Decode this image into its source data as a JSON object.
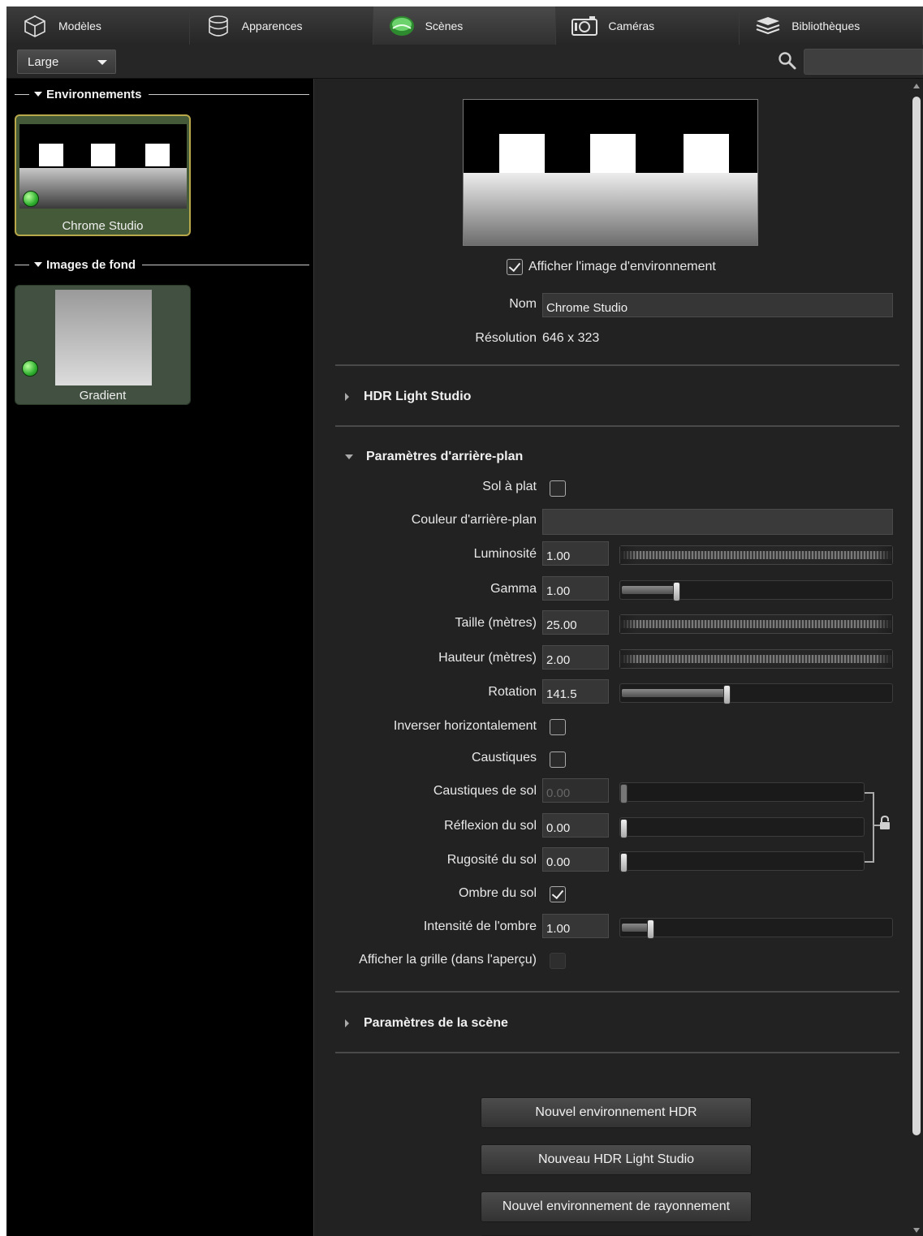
{
  "tabs": [
    {
      "label": "Modèles",
      "icon": "cube-icon"
    },
    {
      "label": "Apparences",
      "icon": "database-cylinder-icon"
    },
    {
      "label": "Scènes",
      "icon": "globe-scene-icon",
      "active": true
    },
    {
      "label": "Caméras",
      "icon": "camera-icon"
    },
    {
      "label": "Bibliothèques",
      "icon": "books-stack-icon"
    }
  ],
  "toolbar": {
    "size_select_value": "Large",
    "search_placeholder": ""
  },
  "library": {
    "environments_header": "Environnements",
    "environment_items": [
      {
        "label": "Chrome Studio",
        "selected": true
      }
    ],
    "backgrounds_header": "Images de fond",
    "background_items": [
      {
        "label": "Gradient"
      }
    ]
  },
  "details": {
    "show_env_image_label": "Afficher l'image d'environnement",
    "show_env_image_checked": true,
    "name_label": "Nom",
    "name_value": "Chrome Studio",
    "resolution_label": "Résolution",
    "resolution_value": "646 x 323",
    "hdr_light_studio_header": "HDR Light Studio",
    "background_params_header": "Paramètres d'arrière-plan",
    "scene_params_header": "Paramètres de la scène"
  },
  "params": {
    "flat_floor": {
      "label": "Sol à plat",
      "checked": false
    },
    "bg_color": {
      "label": "Couleur d'arrière-plan",
      "value": ""
    },
    "brightness": {
      "label": "Luminosité",
      "value": "1.00"
    },
    "gamma": {
      "label": "Gamma",
      "value": "1.00",
      "level": 0.2
    },
    "size": {
      "label": "Taille (mètres)",
      "value": "25.00"
    },
    "height": {
      "label": "Hauteur (mètres)",
      "value": "2.00"
    },
    "rotation": {
      "label": "Rotation",
      "value": "141.5",
      "level": 0.39
    },
    "flip_horizontal": {
      "label": "Inverser horizontalement",
      "checked": false
    },
    "caustics": {
      "label": "Caustiques",
      "checked": false
    },
    "floor_caustics": {
      "label": "Caustiques de sol",
      "value": "0.00",
      "level": 0
    },
    "floor_reflection": {
      "label": "Réflexion du sol",
      "value": "0.00",
      "level": 0
    },
    "floor_roughness": {
      "label": "Rugosité du sol",
      "value": "0.00",
      "level": 0
    },
    "floor_shadow": {
      "label": "Ombre du sol",
      "checked": true
    },
    "shadow_intensity": {
      "label": "Intensité de l'ombre",
      "value": "1.00",
      "level": 0.1
    },
    "show_grid": {
      "label": "Afficher la grille (dans l'aperçu)",
      "checked": false
    }
  },
  "buttons": {
    "new_hdr_env": "Nouvel environnement HDR",
    "new_hdr_light_studio": "Nouveau HDR Light Studio",
    "new_radiance_env": "Nouvel environnement de rayonnement"
  }
}
